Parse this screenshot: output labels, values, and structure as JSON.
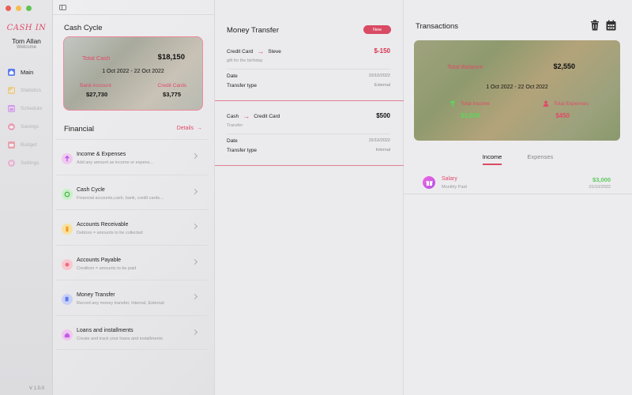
{
  "window": {
    "controls": [
      "close",
      "minimize",
      "zoom"
    ]
  },
  "sidebar": {
    "brand": "CASH IN",
    "user_name": "Tom Allan",
    "user_subtitle": "Welcome",
    "items": [
      {
        "label": "Main",
        "icon": "home-icon",
        "active": true,
        "color": "#5a7bf0"
      },
      {
        "label": "Statistics",
        "icon": "chart-icon",
        "active": false,
        "color": "#f0b840"
      },
      {
        "label": "Schedule",
        "icon": "calendar-icon",
        "active": false,
        "color": "#c45ce8"
      },
      {
        "label": "Savings",
        "icon": "piggy-bank-icon",
        "active": false,
        "color": "#f06b8e"
      },
      {
        "label": "Budget",
        "icon": "wallet-icon",
        "active": false,
        "color": "#f06b7a"
      },
      {
        "label": "Settings",
        "icon": "gear-icon",
        "active": false,
        "color": "#e88ec0"
      }
    ],
    "version": "V 1.0.0"
  },
  "cash_cycle": {
    "title": "Cash Cycle",
    "total_label": "Total Cash",
    "total_value": "$18,150",
    "date_range": "1 Oct 2022 - 22 Oct 2022",
    "bank_label": "Bank Account",
    "bank_value": "$27,730",
    "credit_label": "Credit Cards",
    "credit_value": "$3,775"
  },
  "financial": {
    "title": "Financial",
    "details_label": "Details",
    "items": [
      {
        "title": "Income & Expenses",
        "subtitle": "Add any amount as income or expens...",
        "icon": "income-expenses-icon",
        "color": "#f0c0f0"
      },
      {
        "title": "Cash Cycle",
        "subtitle": "Financial accounts,cash, bank, credit cards...",
        "icon": "cash-cycle-icon",
        "color": "#c8f0c8"
      },
      {
        "title": "Accounts Receivable",
        "subtitle": "Debtors = amounts to be collected",
        "icon": "receivable-icon",
        "color": "#f8e0a0"
      },
      {
        "title": "Accounts Payable",
        "subtitle": "Creditors = amounts to be paid",
        "icon": "payable-icon",
        "color": "#f8c8d0"
      },
      {
        "title": "Money Transfer",
        "subtitle": "Record any money transfer, Internal, External",
        "icon": "transfer-icon",
        "color": "#c8d0f8"
      },
      {
        "title": "Loans and installments",
        "subtitle": "Create and track your loans and installments",
        "icon": "loans-icon",
        "color": "#f0c8f0"
      }
    ]
  },
  "money_transfer": {
    "title": "Money Transfer",
    "new_label": "New",
    "transfers": [
      {
        "from": "Credit Card",
        "to": "Steve",
        "amount": "$-150",
        "amount_color": "#d9304f",
        "note": "gift for the birthday",
        "date_label": "Date",
        "date_value": "10/10/2022",
        "type_label": "Transfer type",
        "type_value": "External"
      },
      {
        "from": "Cash",
        "to": "Credit Card",
        "amount": "$500",
        "amount_color": "#111111",
        "note": "Transfer",
        "date_label": "Date",
        "date_value": "15/10/2022",
        "type_label": "Transfer type",
        "type_value": "Internal"
      }
    ]
  },
  "transactions": {
    "title": "Transactions",
    "summary_label": "Total Balance",
    "summary_value": "$2,550",
    "date_range": "1 Oct 2022 - 22 Oct 2022",
    "income_label": "Total Income",
    "income_value": "$3,000",
    "expenses_label": "Total Expenses",
    "expenses_value": "$450",
    "tabs": [
      "Income",
      "Expenses"
    ],
    "active_tab": "Income",
    "items": [
      {
        "title": "Salary",
        "subtitle": "Monthly Paid",
        "amount": "$3,000",
        "date": "01/10/2022",
        "icon": "gift-icon"
      }
    ]
  }
}
